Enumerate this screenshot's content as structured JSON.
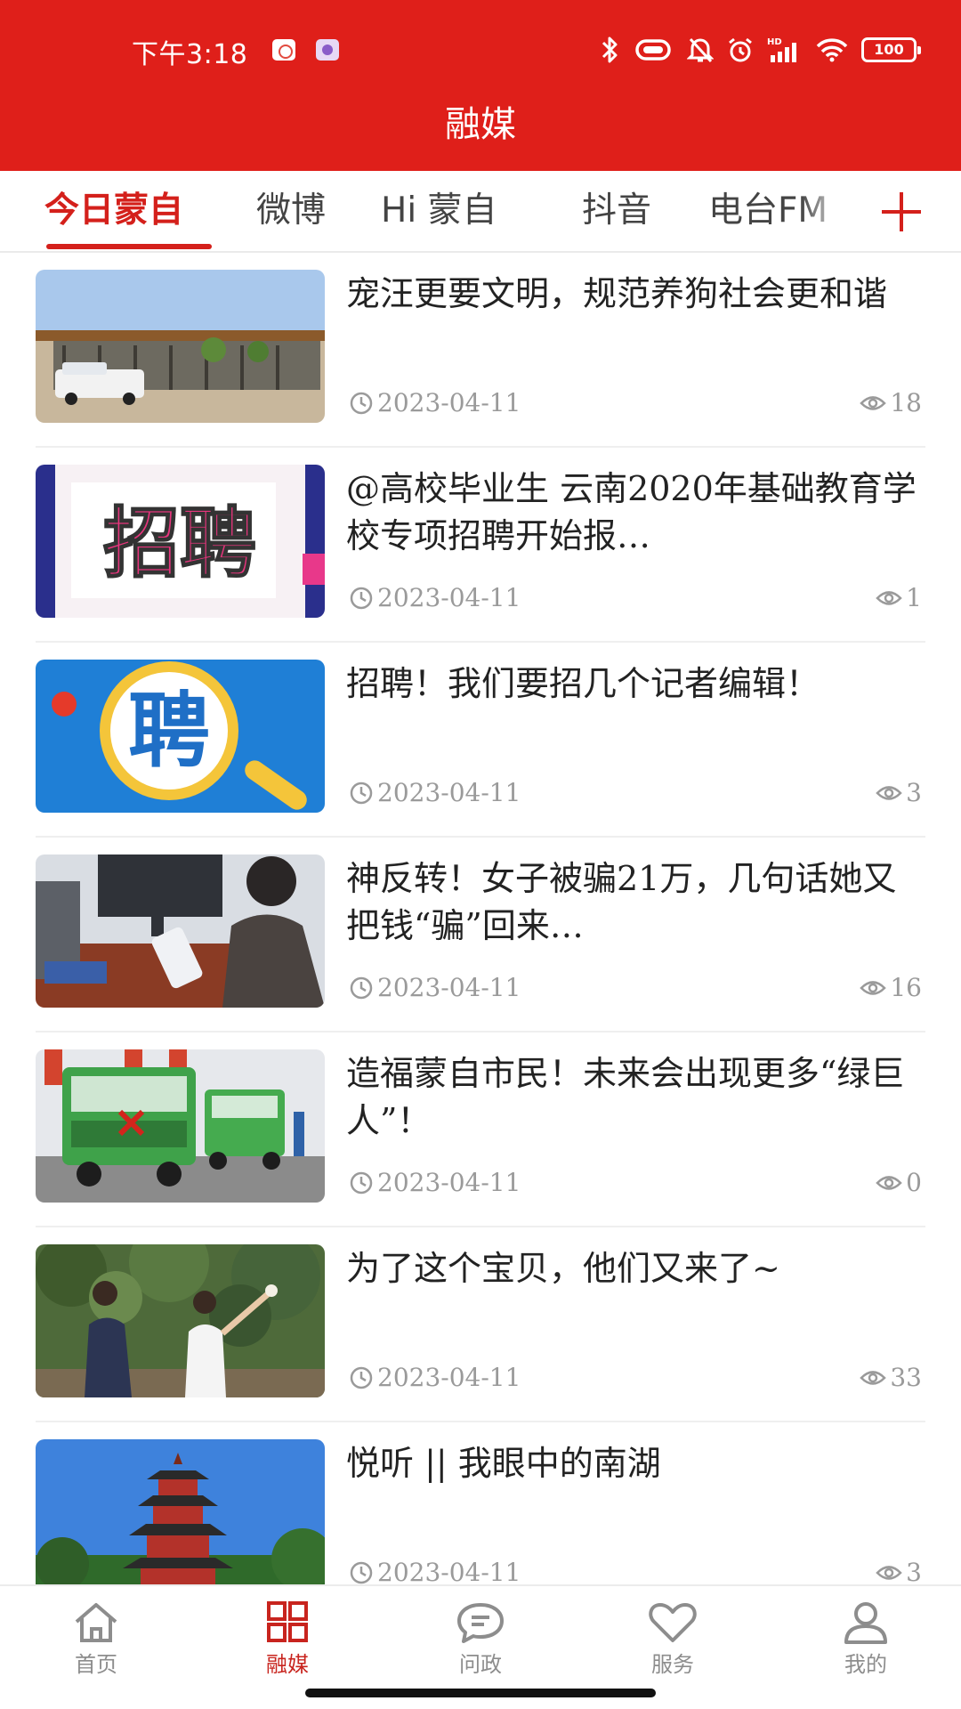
{
  "status_bar": {
    "time": "下午3:18",
    "battery": "100",
    "network_badge": "HD"
  },
  "header": {
    "title": "融媒"
  },
  "tabs": [
    {
      "label": "今日蒙自",
      "active": true
    },
    {
      "label": "微博",
      "active": false
    },
    {
      "label": "Hi 蒙自",
      "active": false
    },
    {
      "label": "抖音",
      "active": false
    },
    {
      "label": "电台FM",
      "active": false
    }
  ],
  "articles": [
    {
      "title": "宠汪更要文明，规范养狗社会更和谐",
      "date": "2023-04-11",
      "views": "18",
      "thumb": "building-with-truck"
    },
    {
      "title": "@高校毕业生 云南2020年基础教育学校专项招聘开始报…",
      "date": "2023-04-11",
      "views": "1",
      "thumb": "zhaopin-banner"
    },
    {
      "title": "招聘！我们要招几个记者编辑！",
      "date": "2023-04-11",
      "views": "3",
      "thumb": "pin-magnifier"
    },
    {
      "title": "神反转！女子被骗21万，几句话她又把钱“骗”回来…",
      "date": "2023-04-11",
      "views": "16",
      "thumb": "woman-at-counter"
    },
    {
      "title": "造福蒙自市民！未来会出现更多“绿巨人”！",
      "date": "2023-04-11",
      "views": "0",
      "thumb": "green-trucks"
    },
    {
      "title": "为了这个宝贝，他们又来了~",
      "date": "2023-04-11",
      "views": "33",
      "thumb": "orchard-workers"
    },
    {
      "title": "悦听 || 我眼中的南湖",
      "date": "2023-04-11",
      "views": "3",
      "thumb": "pagoda"
    }
  ],
  "thumb_text": {
    "zhaopin": "招聘",
    "pin": "聘"
  },
  "bottom_nav": [
    {
      "label": "首页",
      "icon": "home-icon",
      "active": false
    },
    {
      "label": "融媒",
      "icon": "grid-icon",
      "active": true
    },
    {
      "label": "问政",
      "icon": "chat-icon",
      "active": false
    },
    {
      "label": "服务",
      "icon": "heart-icon",
      "active": false
    },
    {
      "label": "我的",
      "icon": "user-icon",
      "active": false
    }
  ],
  "colors": {
    "brand_red": "#df1f1a",
    "accent_red": "#d4201b",
    "meta_gray": "#9a9a9a"
  }
}
